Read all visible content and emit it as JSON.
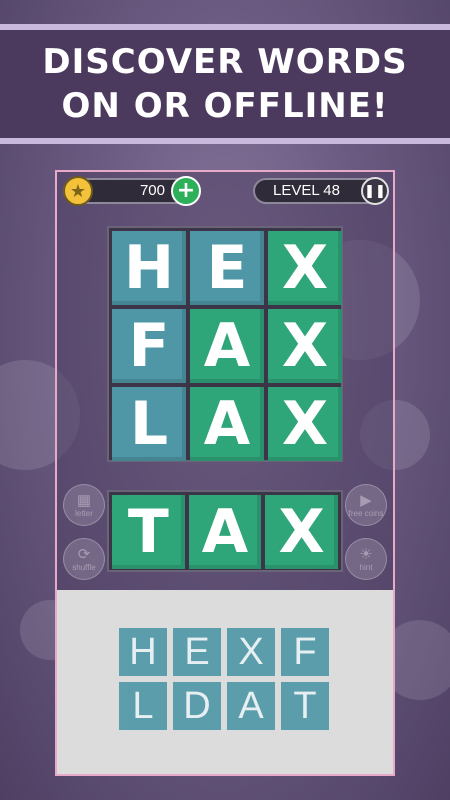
{
  "banner": {
    "line1": "DISCOVER WORDS",
    "line2": "ON OR OFFLINE!"
  },
  "hud": {
    "score": "700",
    "level": "LEVEL 48",
    "plus_label": "+",
    "star_icon": "star-icon",
    "pause_icon": "pause-icon"
  },
  "grid": {
    "rows": [
      [
        {
          "letter": "H",
          "color": "teal"
        },
        {
          "letter": "E",
          "color": "teal"
        },
        {
          "letter": "X",
          "color": "green"
        }
      ],
      [
        {
          "letter": "F",
          "color": "teal"
        },
        {
          "letter": "A",
          "color": "green"
        },
        {
          "letter": "X",
          "color": "green"
        }
      ],
      [
        {
          "letter": "L",
          "color": "teal"
        },
        {
          "letter": "A",
          "color": "green"
        },
        {
          "letter": "X",
          "color": "green"
        }
      ]
    ]
  },
  "answer": {
    "letters": [
      "T",
      "A",
      "X"
    ]
  },
  "side_buttons": [
    {
      "name": "left-top",
      "icon": "tile-hint-icon",
      "label": "letter"
    },
    {
      "name": "left-bottom",
      "icon": "shuffle-icon",
      "label": "shuffle"
    },
    {
      "name": "right-top",
      "icon": "video-icon",
      "label": "free coins"
    },
    {
      "name": "right-bottom",
      "icon": "lightbulb-icon",
      "label": "hint"
    }
  ],
  "tray": {
    "letters": [
      "H",
      "E",
      "X",
      "F",
      "L",
      "D",
      "A",
      "T"
    ]
  },
  "colors": {
    "teal": "#4f97a6",
    "green": "#2fa57a",
    "banner": "#4b3a5e",
    "frame_border": "#e9a9c9"
  }
}
